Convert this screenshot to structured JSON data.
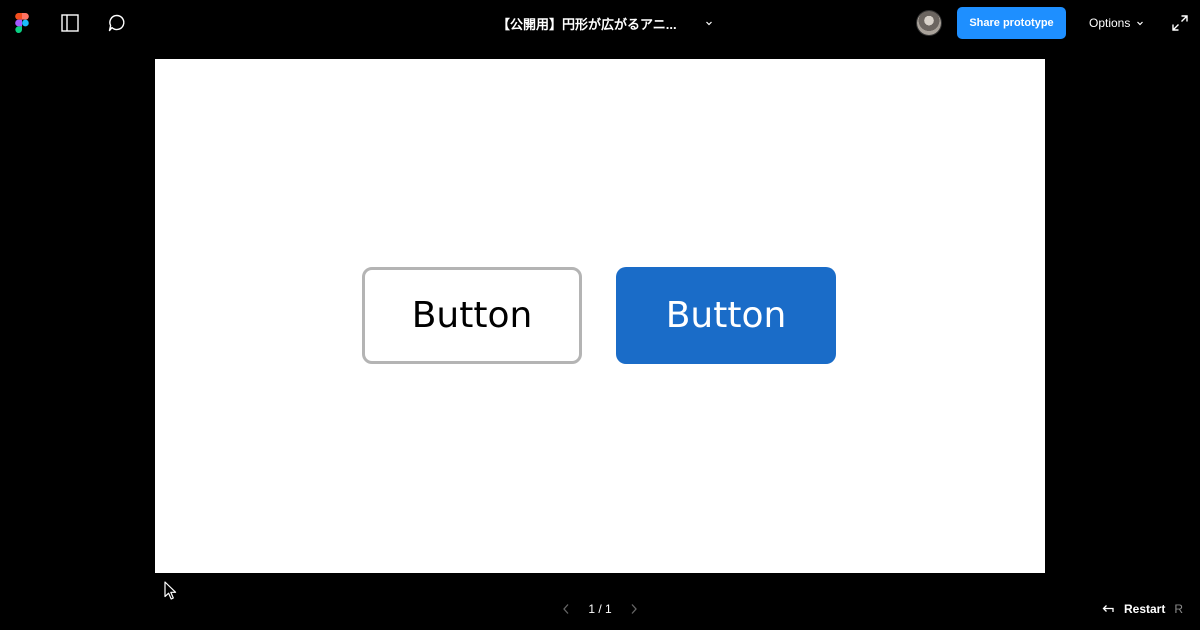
{
  "toolbar": {
    "title": "【公開用】円形が広がるアニ...",
    "share_label": "Share prototype",
    "options_label": "Options",
    "icons": {
      "logo": "figma-logo-icon",
      "sidebar": "sidebar-panel-icon",
      "comment": "comment-bubble-icon",
      "title_menu": "chevron-down-icon",
      "options_menu": "chevron-down-icon",
      "expand": "expand-arrows-icon"
    }
  },
  "canvas": {
    "buttons": [
      {
        "label": "Button",
        "style": "outline"
      },
      {
        "label": "Button",
        "style": "filled"
      }
    ]
  },
  "footer": {
    "page_indicator": "1 / 1",
    "restart_label": "Restart",
    "restart_shortcut": "R",
    "icons": {
      "prev": "chevron-left-icon",
      "next": "chevron-right-icon",
      "restart": "arrow-left-icon"
    }
  },
  "colors": {
    "background": "#000000",
    "share_button": "#1e8fff",
    "filled_button": "#1a6cc8",
    "outline_border": "#b4b4b4",
    "canvas": "#ffffff"
  }
}
